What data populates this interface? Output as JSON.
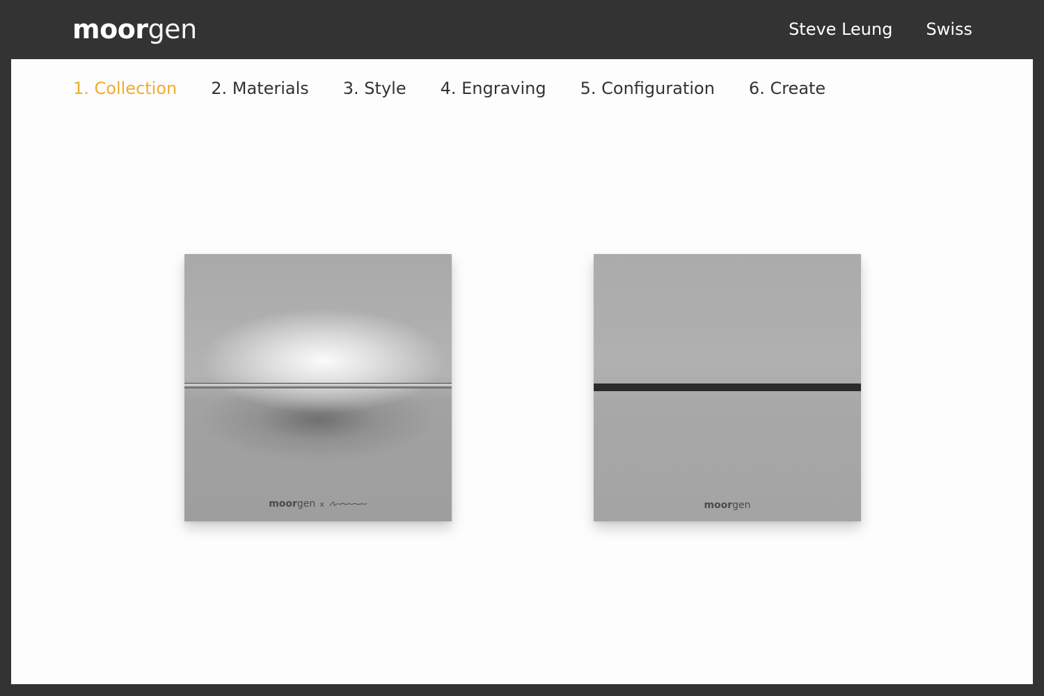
{
  "header": {
    "logo_bold": "moor",
    "logo_light": "gen",
    "user_name": "Steve Leung",
    "language": "Swiss"
  },
  "steps": [
    {
      "label": "1. Collection",
      "active": true
    },
    {
      "label": "2. Materials",
      "active": false
    },
    {
      "label": "3. Style",
      "active": false
    },
    {
      "label": "4. Engraving",
      "active": false
    },
    {
      "label": "5. Configuration",
      "active": false
    },
    {
      "label": "6. Create",
      "active": false
    }
  ],
  "products": [
    {
      "brand_bold": "moor",
      "brand_light": "gen",
      "collab_x": "x",
      "divider": "silver"
    },
    {
      "brand_bold": "moor",
      "brand_light": "gen",
      "divider": "black"
    }
  ],
  "colors": {
    "header_bg": "#333333",
    "content_bg": "#fdfdfd",
    "accent": "#f0ad2b",
    "text": "#333333"
  }
}
